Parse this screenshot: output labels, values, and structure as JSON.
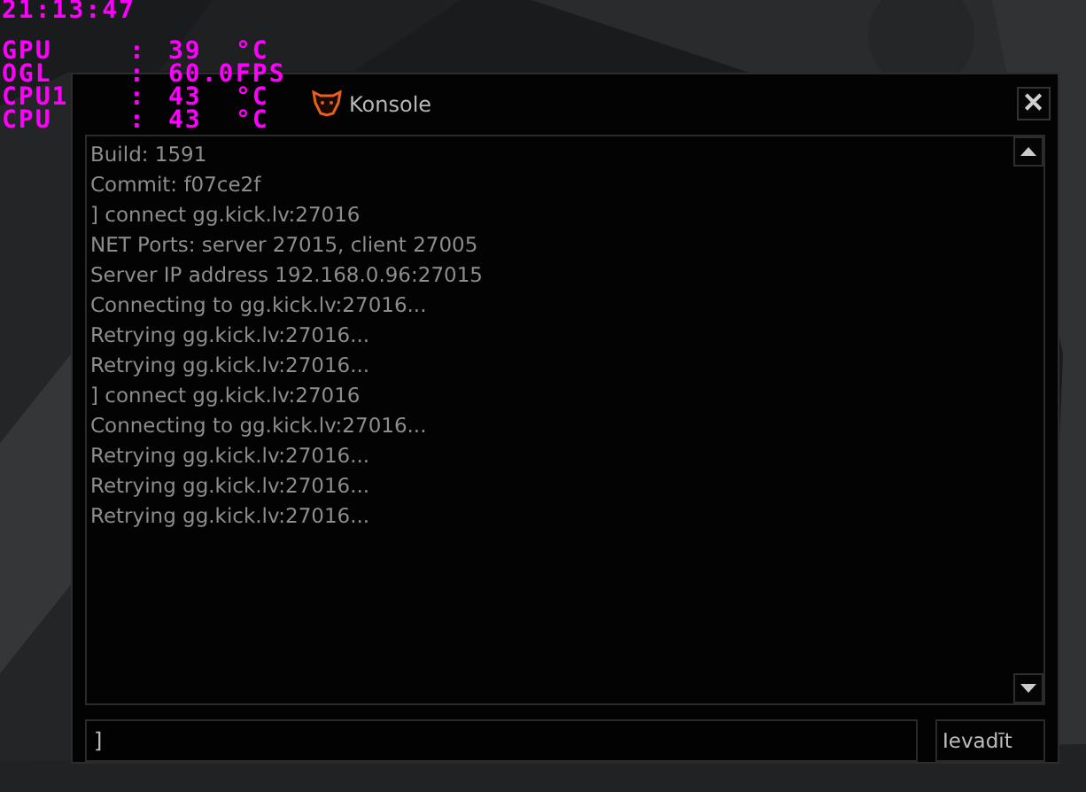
{
  "hud": {
    "clock": "21:13:47",
    "stats": [
      {
        "label": "GPU",
        "separator": ":",
        "value": "39",
        "unit": "°C"
      },
      {
        "label": "OGL",
        "separator": ":",
        "value": "60.0",
        "unit": "FPS"
      },
      {
        "label": "CPU1",
        "separator": ":",
        "value": "43",
        "unit": "°C"
      },
      {
        "label": "CPU",
        "separator": ":",
        "value": "43",
        "unit": "°C"
      }
    ]
  },
  "console": {
    "title": "Konsole",
    "close": "✕",
    "log": [
      "Build: 1591",
      "Commit: f07ce2f",
      "] connect gg.kick.lv:27016",
      "NET Ports:  server 27015, client 27005",
      "Server IP address 192.168.0.96:27015",
      "Connecting to gg.kick.lv:27016...",
      "Retrying gg.kick.lv:27016...",
      "Retrying gg.kick.lv:27016...",
      "] connect gg.kick.lv:27016",
      "Connecting to gg.kick.lv:27016...",
      "Retrying gg.kick.lv:27016...",
      "Retrying gg.kick.lv:27016...",
      "Retrying gg.kick.lv:27016..."
    ],
    "input": {
      "value": "]"
    },
    "submit": "Ievadīt"
  }
}
